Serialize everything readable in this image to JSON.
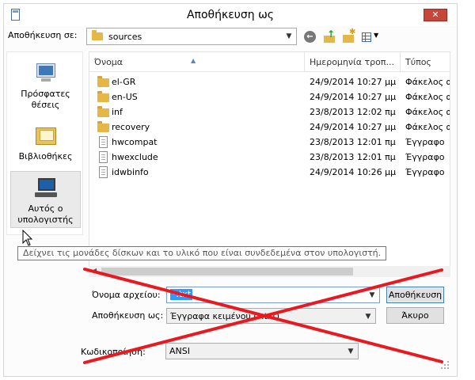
{
  "window": {
    "title": "Αποθήκευση ως",
    "close_label": "✕"
  },
  "toolbar": {
    "savein_label": "Αποθήκευση σε:",
    "savein_value": "sources",
    "icons": [
      "back-icon",
      "up-folder-icon",
      "new-folder-icon",
      "view-menu-icon"
    ]
  },
  "places": {
    "recent": "Πρόσφατες θέσεις",
    "libraries": "Βιβλιοθήκες",
    "computer": "Αυτός ο υπολογιστής"
  },
  "list": {
    "columns": {
      "name": "Όνομα",
      "date": "Ημερομηνία τροπ...",
      "type": "Τύπος"
    },
    "rows": [
      {
        "name": "el-GR",
        "date": "24/9/2014 10:27 μμ",
        "type": "Φάκελος α",
        "icon": "folder-icon"
      },
      {
        "name": "en-US",
        "date": "24/9/2014 10:27 μμ",
        "type": "Φάκελος α",
        "icon": "folder-icon"
      },
      {
        "name": "inf",
        "date": "23/8/2013 12:02 πμ",
        "type": "Φάκελος α",
        "icon": "folder-icon"
      },
      {
        "name": "recovery",
        "date": "24/9/2014 10:27 μμ",
        "type": "Φάκελος α",
        "icon": "folder-icon"
      },
      {
        "name": "hwcompat",
        "date": "23/8/2013 12:01 πμ",
        "type": "Έγγραφο",
        "icon": "document-icon"
      },
      {
        "name": "hwexclude",
        "date": "23/8/2013 12:01 πμ",
        "type": "Έγγραφο",
        "icon": "document-icon"
      },
      {
        "name": "idwbinfo",
        "date": "24/9/2014 10:26 μμ",
        "type": "Έγγραφο",
        "icon": "document-icon"
      }
    ]
  },
  "tooltip": "Δείχνει τις μονάδες δίσκων και το υλικό που είναι συνδεδεμένα στον υπολογιστή.",
  "form": {
    "filename_label": "Όνομα αρχείου:",
    "filename_value": "*.txt",
    "savetype_label": "Αποθήκευση ως:",
    "savetype_value": "Έγγραφα κειμένου (*.txt)",
    "encoding_label": "Κωδικοποίηση:",
    "encoding_value": "ANSI"
  },
  "buttons": {
    "save": "Αποθήκευση",
    "cancel": "Άκυρο"
  },
  "colors": {
    "cross": "#e8191f",
    "accent": "#3399ff",
    "close": "#c7463a"
  }
}
